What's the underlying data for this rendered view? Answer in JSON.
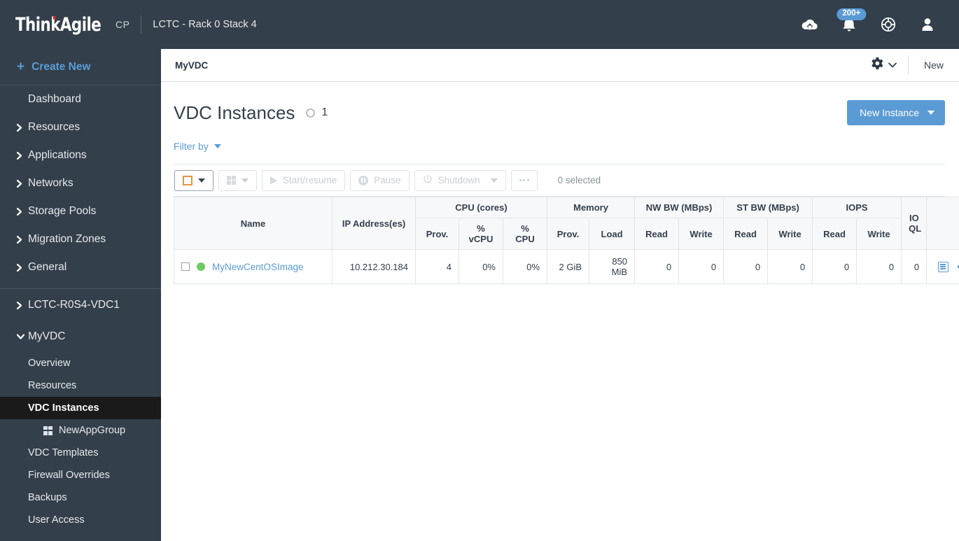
{
  "topbar": {
    "logo_text": "ThinkAgile",
    "logo_suffix": "CP",
    "subtitle": "LCTC - Rack 0 Stack 4",
    "icons": [
      {
        "name": "cloud-download-icon",
        "label": "Downloads"
      },
      {
        "name": "notification-bell-icon",
        "label": "Notifications",
        "badge": "200+"
      },
      {
        "name": "help-icon",
        "label": "Help"
      },
      {
        "name": "user-account-icon",
        "label": "Account"
      }
    ]
  },
  "sidebar": {
    "create_new": "Create New",
    "items": [
      {
        "label": "Dashboard",
        "expandable": false
      },
      {
        "label": "Resources",
        "expandable": true,
        "state": "collapsed"
      },
      {
        "label": "Applications",
        "expandable": true,
        "state": "collapsed"
      },
      {
        "label": "Networks",
        "expandable": true,
        "state": "collapsed"
      },
      {
        "label": "Storage Pools",
        "expandable": true,
        "state": "collapsed"
      },
      {
        "label": "Migration Zones",
        "expandable": true,
        "state": "collapsed"
      },
      {
        "label": "General",
        "expandable": true,
        "state": "collapsed"
      }
    ],
    "vdc_items": [
      {
        "label": "LCTC-R0S4-VDC1",
        "expandable": true,
        "state": "collapsed"
      },
      {
        "label": "MyVDC",
        "expandable": true,
        "state": "expanded"
      }
    ],
    "sub_items": [
      {
        "label": "Overview",
        "active": false,
        "icon": null
      },
      {
        "label": "Resources",
        "active": false,
        "icon": null
      },
      {
        "label": "VDC Instances",
        "active": true,
        "icon": null
      },
      {
        "label": "NewAppGroup",
        "active": false,
        "icon": "app-group-grid-icon"
      },
      {
        "label": "VDC Templates",
        "active": false,
        "icon": null
      },
      {
        "label": "Firewall Overrides",
        "active": false,
        "icon": null
      },
      {
        "label": "Backups",
        "active": false,
        "icon": null
      },
      {
        "label": "User Access",
        "active": false,
        "icon": null
      }
    ]
  },
  "breadcrumb": {
    "current": "MyVDC",
    "gear_label": "Settings",
    "new_label": "New"
  },
  "page": {
    "title": "VDC Instances",
    "count": "1",
    "new_instance_label": "New Instance",
    "filter_label": "Filter by"
  },
  "toolbar": {
    "select_label": "",
    "view_label": "",
    "start_label": "Start/resume",
    "pause_label": "Pause",
    "shutdown_label": "Shutdown",
    "more_label": "",
    "selected_text": "0 selected"
  },
  "table": {
    "group_headers": [
      {
        "label": "",
        "span": 1
      },
      {
        "label": "",
        "span": 1
      },
      {
        "label": "CPU (cores)",
        "span": 3
      },
      {
        "label": "Memory",
        "span": 2
      },
      {
        "label": "NW BW (MBps)",
        "span": 2
      },
      {
        "label": "ST BW (MBps)",
        "span": 2
      },
      {
        "label": "IOPS",
        "span": 2
      },
      {
        "label": "IO QL",
        "span": 1
      },
      {
        "label": "",
        "span": 1
      }
    ],
    "columns": [
      "Name",
      "IP Address(es)",
      "Prov.",
      "% vCPU",
      "% CPU",
      "Prov.",
      "Load",
      "Read",
      "Write",
      "Read",
      "Write",
      "Read",
      "Write",
      "IO QL",
      ""
    ],
    "rows": [
      {
        "status": "running",
        "name": "MyNewCentOSImage",
        "ip": "10.212.30.184",
        "cpu_prov": "4",
        "cpu_vcpu_pct": "0%",
        "cpu_pct": "0%",
        "mem_prov": "2 GiB",
        "mem_load": "850 MiB",
        "nw_read": "0",
        "nw_write": "0",
        "st_read": "0",
        "st_write": "0",
        "iops_read": "0",
        "iops_write": "0",
        "io_ql": "0"
      }
    ]
  },
  "colors": {
    "chrome": "#333f4a",
    "accent": "#5b9bd5",
    "status_running": "#6ecb63",
    "active_nav": "#1a1a1a",
    "logo_dot": "#e2231a",
    "checkbox_orange": "#e8943a"
  }
}
